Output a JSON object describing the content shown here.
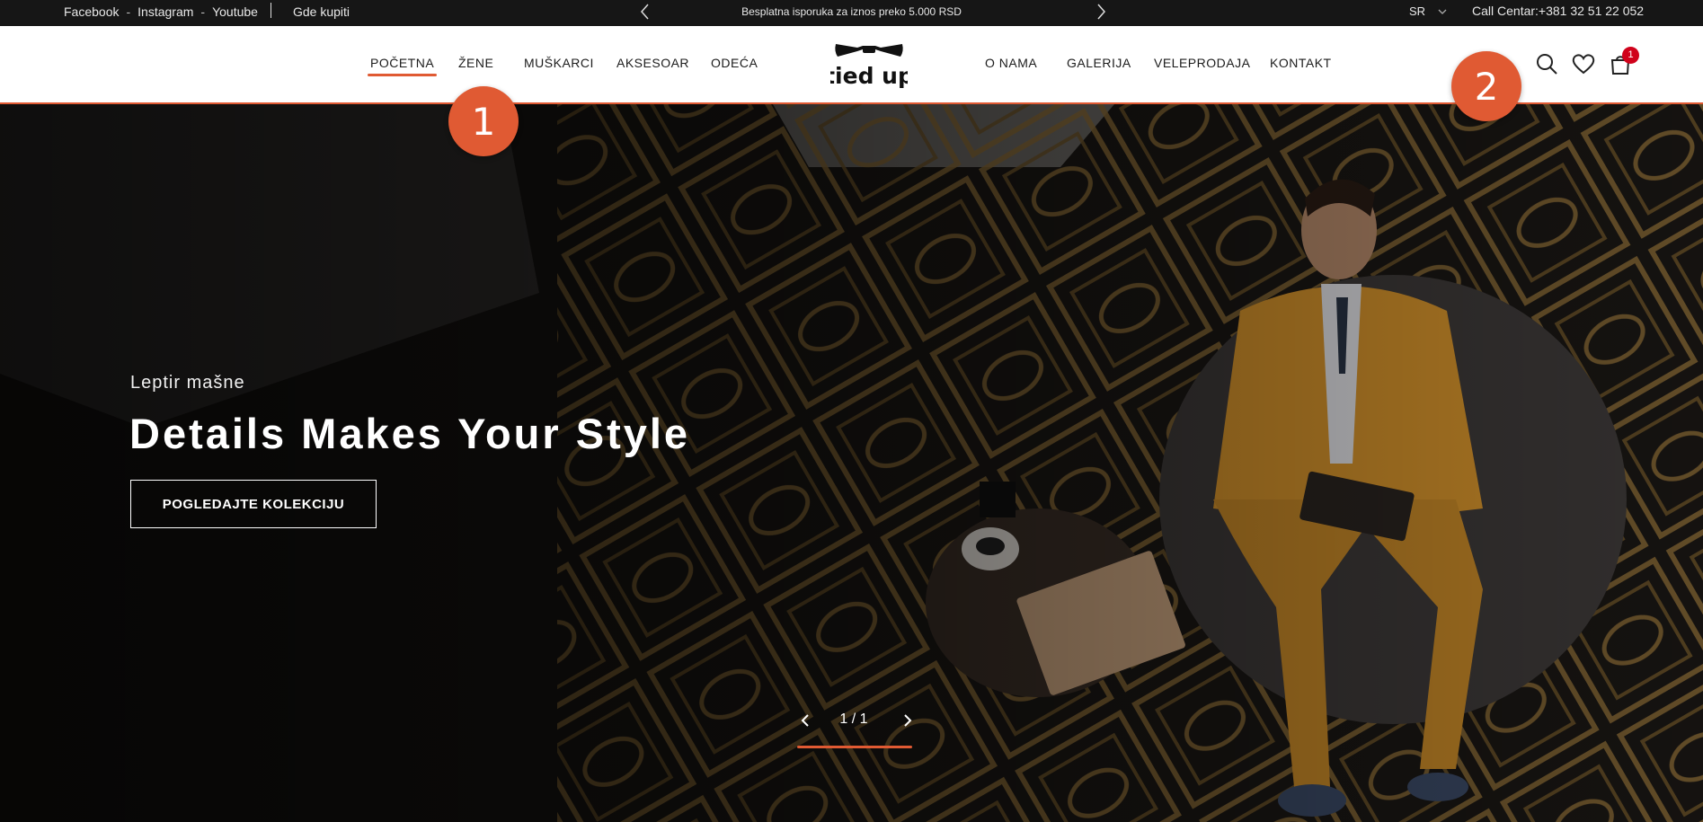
{
  "topbar": {
    "social": [
      "Facebook",
      "Instagram",
      "Youtube"
    ],
    "social_separator": "-",
    "where_to_buy": "Gde kupiti",
    "promo": "Besplatna isporuka za iznos preko 5.000 RSD",
    "language": "SR",
    "call_center": "Call Centar:+381 32 51 22 052"
  },
  "nav": {
    "left_items": [
      "POČETNA",
      "ŽENE",
      "MUŠKARCI",
      "AKSESOAR",
      "ODEĆA"
    ],
    "right_items": [
      "O NAMA",
      "GALERIJA",
      "VELEPRODAJA",
      "KONTAKT"
    ],
    "active_item": "POČETNA",
    "logo_text": "tied up",
    "cart_count": "1"
  },
  "hero": {
    "eyebrow": "Leptir mašne",
    "headline": "Details Makes Your Style",
    "cta": "POGLEDAJTE KOLEKCIJU"
  },
  "slider": {
    "counter": "1 / 1"
  },
  "markers": [
    "1",
    "2"
  ],
  "colors": {
    "accent": "#e05a33",
    "topbar_bg": "#161616",
    "cart_badge": "#d0021b",
    "suit": "#d8952c"
  }
}
